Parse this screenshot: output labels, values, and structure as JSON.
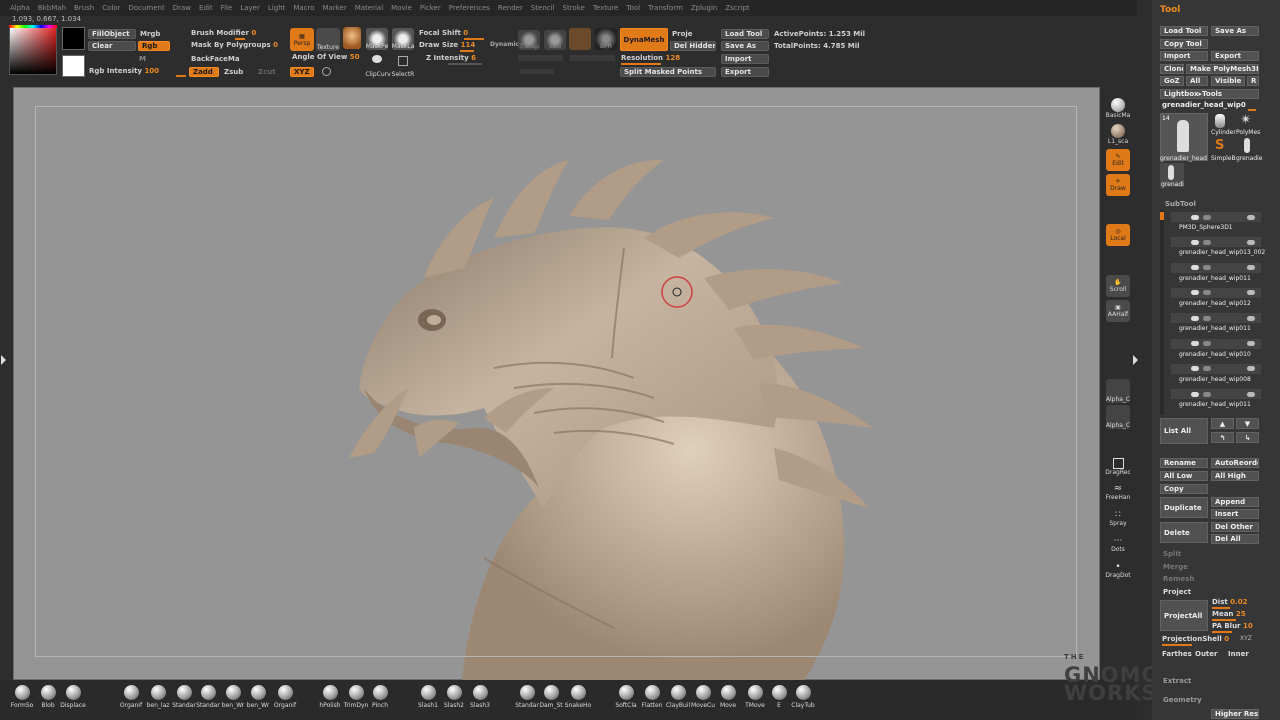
{
  "menubar": [
    "Alpha",
    "BkbMah",
    "Brush",
    "Color",
    "Document",
    "Draw",
    "Edit",
    "File",
    "Layer",
    "Light",
    "Macro",
    "Marker",
    "Material",
    "Movie",
    "Picker",
    "Preferences",
    "Render",
    "Stencil",
    "Stroke",
    "Texture",
    "Tool",
    "Transform",
    "Zplugin",
    "Zscript"
  ],
  "coords": "1.093, 0.667, 1.034",
  "color": {
    "fill_object": "FillObject",
    "clear": "Clear",
    "mrgb": "Mrgb",
    "rgb": "Rgb",
    "m": "M",
    "rgb_intensity_label": "Rgb Intensity",
    "rgb_intensity_value": "100"
  },
  "brush": {
    "modifier_label": "Brush Modifier",
    "modifier_value": "0",
    "mask_label": "Mask By Polygroups",
    "mask_value": "0",
    "backface": "BackFaceMa",
    "zadd": "Zadd",
    "zsub": "Zsub",
    "zcut": "Zcut"
  },
  "toolbar": {
    "persp": "Persp",
    "texture": "Texture",
    "mask_pen": "MaskPe",
    "mask_lasso": "MaskLa",
    "clip_curve": "ClipCurv",
    "select_rect": "SelectR",
    "angle_label": "Angle Of View",
    "angle_value": "50",
    "xyz": "XYZ",
    "focal_label": "Focal Shift",
    "focal_value": "0",
    "draw_size_label": "Draw Size",
    "draw_size_value": "114",
    "dynamic": "Dynamic",
    "z_intensity_label": "Z Intensity",
    "z_intensity_value": "6",
    "transp": "Transp",
    "solo": "Solo",
    "bpr": "BPR",
    "dynamesh": "DynaMesh",
    "proj": "Proje",
    "del_hidden": "Del Hidden",
    "resolution_label": "Resolution",
    "resolution_value": "128",
    "split_masked": "Split Masked Points",
    "load_tool": "Load Tool",
    "save_as": "Save As",
    "import": "Import",
    "export": "Export",
    "active_points": "ActivePoints: 1.253  Mil",
    "total_points": "TotalPoints: 4.785  Mil"
  },
  "side_shelf": {
    "basic_mat": "BasicMa",
    "mat2": "L1_sca",
    "edit": "Edit",
    "draw": "Draw",
    "local": "Local",
    "scroll": "Scroll",
    "aahalf": "AAHalf",
    "alpha1": "Alpha_C",
    "alpha2": "Alpha_C",
    "drag_rect": "DragRec",
    "freehand": "FreeHan",
    "spray": "Spray",
    "dots": "Dots",
    "drag_dot": "DragDot"
  },
  "tool_panel": {
    "title": "Tool",
    "load_tool": "Load Tool",
    "save_as": "Save As",
    "copy_tool": "Copy Tool",
    "import": "Import",
    "export": "Export",
    "clone": "Clone",
    "make_polymesh": "Make PolyMesh3D",
    "goz": "GoZ",
    "all": "All",
    "visible": "Visible",
    "r": "R",
    "lightbox": "Lightbox▸Tools",
    "current_tool": "grenadier_head_wip0",
    "tool_count": "14",
    "thumbs": [
      "grenadier_head",
      "Cylinder",
      "PolyMes",
      "SimpleB",
      "grenadie",
      "grenadi"
    ],
    "subtool_label": "SubTool",
    "subtools": [
      "PM3D_Sphere3D1",
      "grenadier_head_wip013_002",
      "grenadier_head_wip011",
      "grenadier_head_wip012",
      "grenadier_head_wip011",
      "grenadier_head_wip010",
      "grenadier_head_wip008",
      "grenadier_head_wip011"
    ],
    "list_all": "List All",
    "rename": "Rename",
    "auto_reorder": "AutoReorde",
    "all_low": "All Low",
    "all_high": "All High",
    "copy": "Copy",
    "duplicate": "Duplicate",
    "append": "Append",
    "insert": "Insert",
    "delete": "Delete",
    "del_other": "Del Other",
    "del_all": "Del All",
    "split": "Split",
    "merge": "Merge",
    "remesh": "Remesh",
    "project": "Project",
    "project_all": "ProjectAll",
    "dist_label": "Dist",
    "dist_value": "0.02",
    "mean_label": "Mean",
    "mean_value": "25",
    "pa_blur_label": "PA Blur",
    "pa_blur_value": "10",
    "projection_shell_label": "ProjectionShell",
    "projection_shell_value": "0",
    "xyz": "XYZ",
    "farthest": "Farthes",
    "outer": "Outer",
    "inner": "Inner",
    "extract": "Extract",
    "geometry": "Geometry",
    "higher_res": "Higher Res"
  },
  "brushes": [
    "FormSo",
    "Blob",
    "Displace",
    "Organif",
    "ben_laz",
    "Standar",
    "Standar",
    "ben_Wr",
    "ben_Wr",
    "Organif",
    "hPolish",
    "TrimDyn",
    "Pinch",
    "Slash1",
    "Slash2",
    "Slash3",
    "Standar",
    "Dam_St",
    "SnakeHo",
    "SoftCla",
    "Flatten",
    "ClayBuil",
    "MoveCu",
    "Move",
    "TMove",
    "E",
    "ClayTub",
    "Planar"
  ],
  "watermark": [
    "THE",
    "GNOMON",
    "WORKSHOP"
  ],
  "colors": {
    "accent": "#e07a18",
    "canvas": "#959595",
    "skin": "#b6a28e"
  }
}
